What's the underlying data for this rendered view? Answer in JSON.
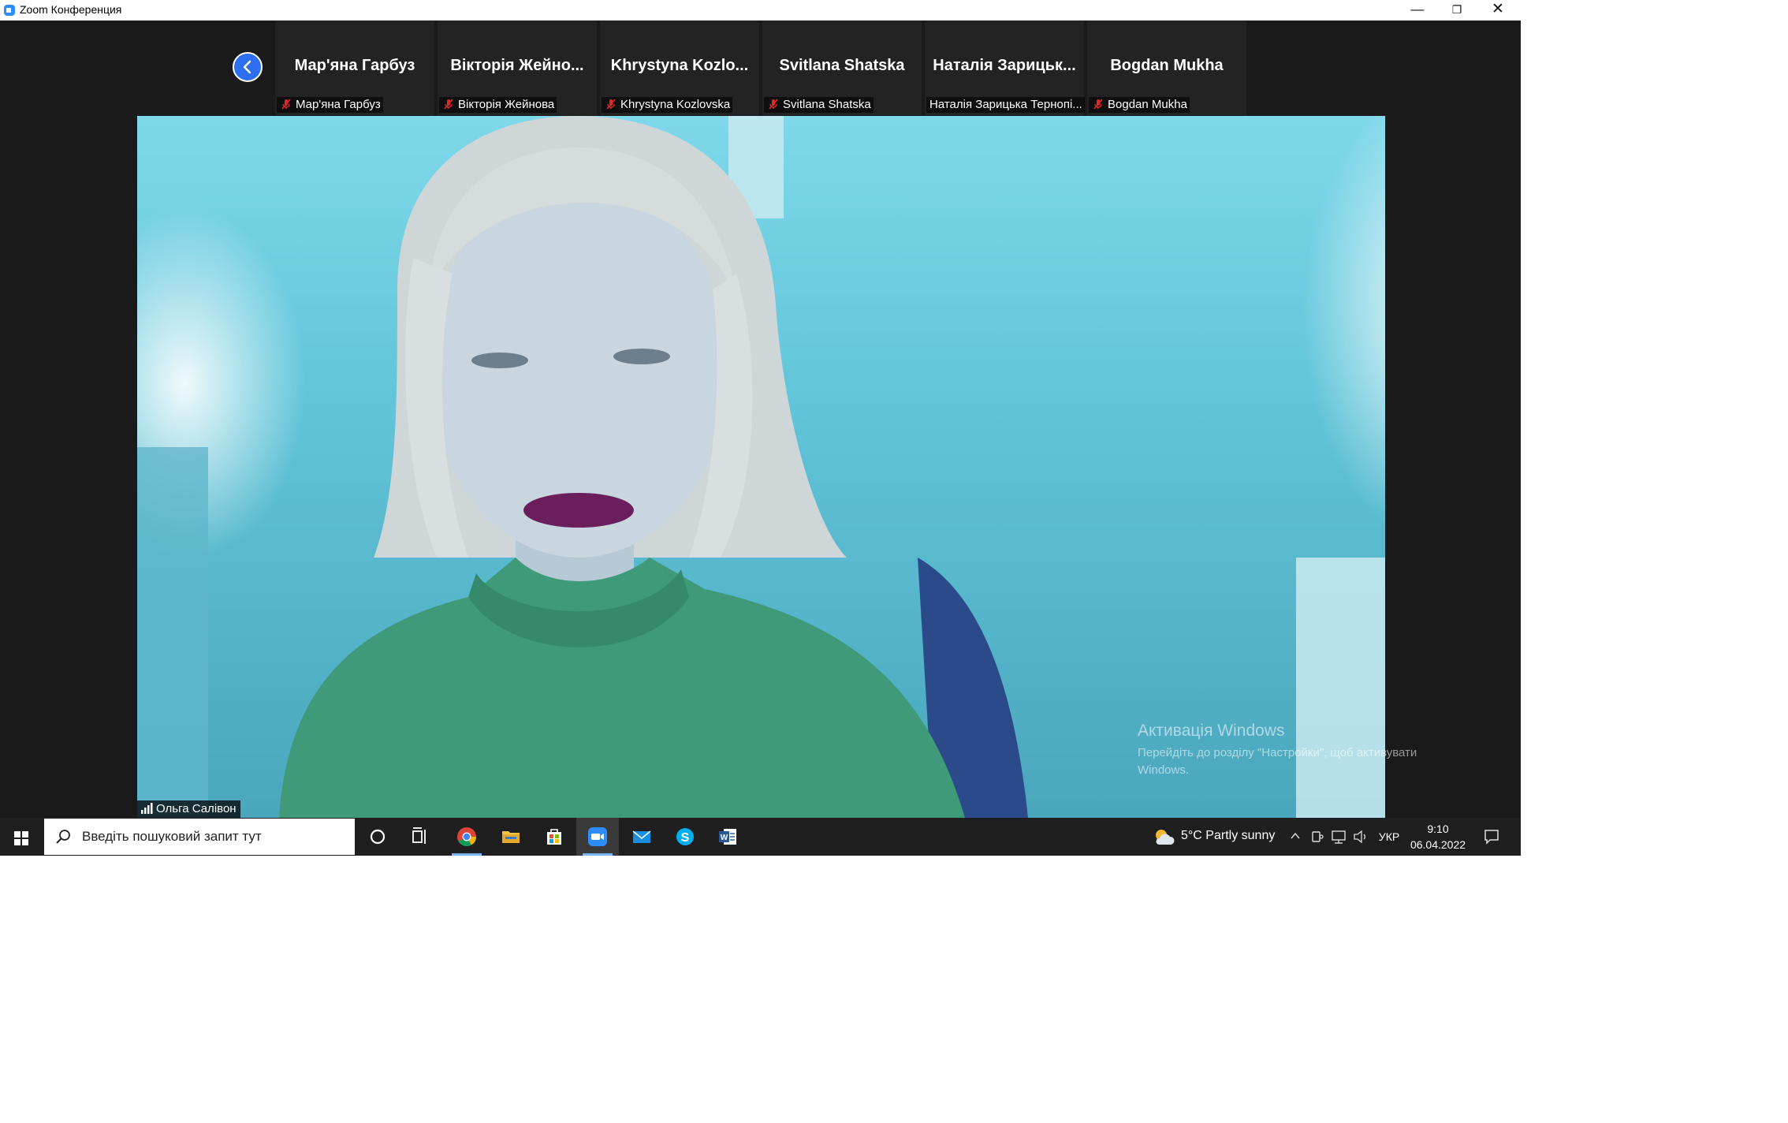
{
  "window": {
    "title": "Zoom Конференция",
    "controls": {
      "minimize": "—",
      "restore": "❐",
      "close": "✕"
    }
  },
  "gallery": [
    {
      "name": "Мар'яна Гарбуз",
      "label": "Мар'яна Гарбуз",
      "mic_muted": true
    },
    {
      "name": "Вікторія  Жейно...",
      "label": "Вікторія Жейнова",
      "mic_muted": true
    },
    {
      "name": "Khrystyna  Kozlo...",
      "label": "Khrystyna Kozlovska",
      "mic_muted": true
    },
    {
      "name": "Svitlana Shatska",
      "label": "Svitlana Shatska",
      "mic_muted": true
    },
    {
      "name": "Наталія Зарицьк...",
      "label": "Наталія Зарицька Тернопі...",
      "mic_muted": false
    },
    {
      "name": "Bogdan Mukha",
      "label": "Bogdan Mukha",
      "mic_muted": true
    }
  ],
  "main_video": {
    "speaker": "Ольга Салівон"
  },
  "activation": {
    "title": "Активація Windows",
    "line1": "Перейдіть до розділу \"Настройки\", щоб активувати",
    "line2": "Windows."
  },
  "taskbar": {
    "search_placeholder": "Введіть пошуковий запит тут",
    "pinned": [
      "cortana-icon",
      "task-view-icon",
      "chrome-icon",
      "file-explorer-icon",
      "store-icon",
      "zoom-icon",
      "mail-icon",
      "skype-icon",
      "word-icon"
    ],
    "weather": "5°C  Partly sunny",
    "language": "УКР",
    "time": "9:10",
    "date": "06.04.2022"
  },
  "colors": {
    "zoom_blue": "#2d8cff",
    "muted_red": "#e02828",
    "taskbar": "#1f1f1f"
  }
}
